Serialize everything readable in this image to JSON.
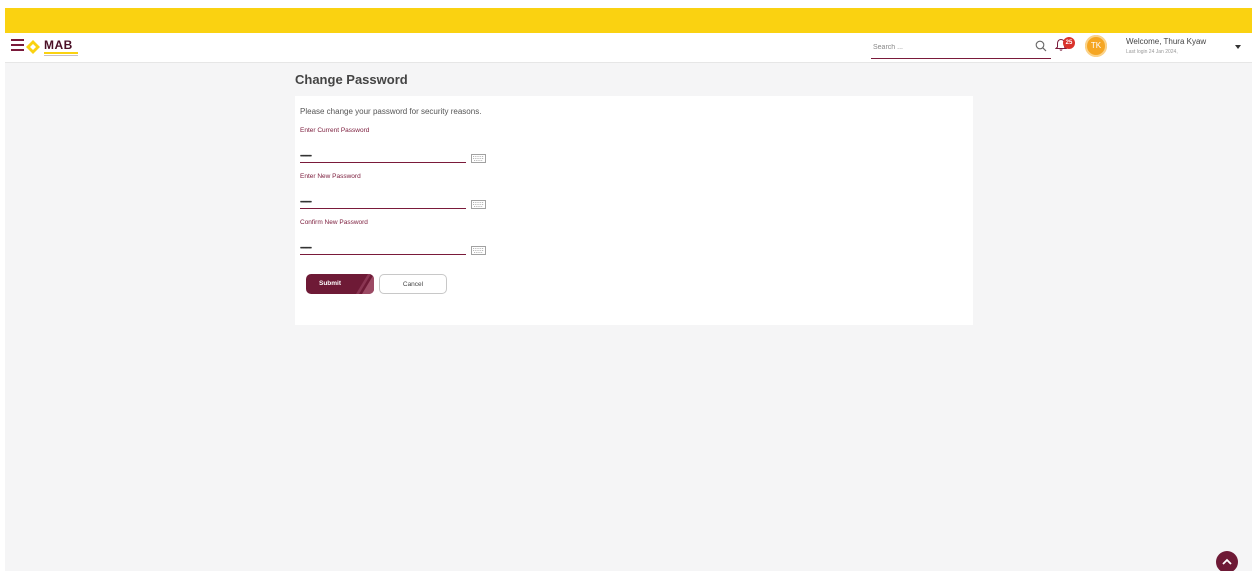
{
  "header": {
    "logo_text": "MAB",
    "search_placeholder": "Search ...",
    "notification_count": "25",
    "avatar_initials": "TK",
    "welcome": "Welcome, Thura Kyaw",
    "last_login": "Last login 24 Jan 2024,"
  },
  "page": {
    "title": "Change Password",
    "intro": "Please change your password for security reasons.",
    "fields": [
      {
        "label": "Enter Current Password",
        "value": "••••••••••"
      },
      {
        "label": "Enter New Password",
        "value": "••••••••••"
      },
      {
        "label": "Confirm New Password",
        "value": "••••••••••"
      }
    ],
    "submit_label": "Submit",
    "cancel_label": "Cancel"
  },
  "colors": {
    "brand_yellow": "#fad211",
    "brand_maroon": "#6e1a36",
    "badge_red": "#d9322b",
    "avatar_orange": "#f5a623"
  },
  "icons": [
    "hamburger-icon",
    "logo-icon",
    "search-icon",
    "bell-icon",
    "keyboard-icon",
    "chevron-up-icon",
    "caret-down-icon"
  ]
}
